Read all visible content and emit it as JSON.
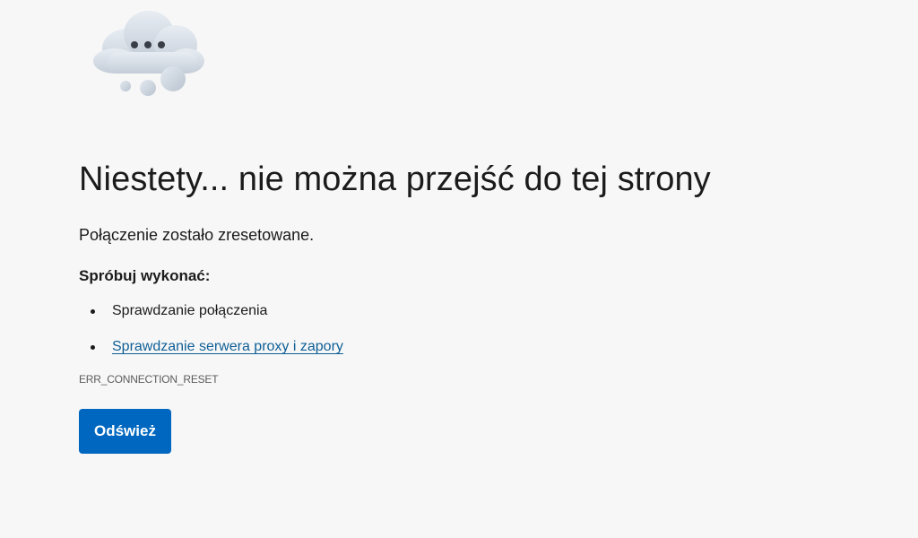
{
  "illustration": {
    "icon": "cloud-thinking-icon"
  },
  "main": {
    "title": "Niestety... nie można przejść do tej strony",
    "subtitle": "Połączenie zostało zresetowane.",
    "try_title": "Spróbuj wykonać:",
    "suggestions": [
      {
        "label": "Sprawdzanie połączenia",
        "link": false
      },
      {
        "label": "Sprawdzanie serwera proxy i zapory",
        "link": true
      }
    ],
    "error_code": "ERR_CONNECTION_RESET",
    "refresh_label": "Odśwież"
  },
  "colors": {
    "background": "#f7f7f7",
    "accent": "#0067c0",
    "link": "#0f5f96"
  }
}
